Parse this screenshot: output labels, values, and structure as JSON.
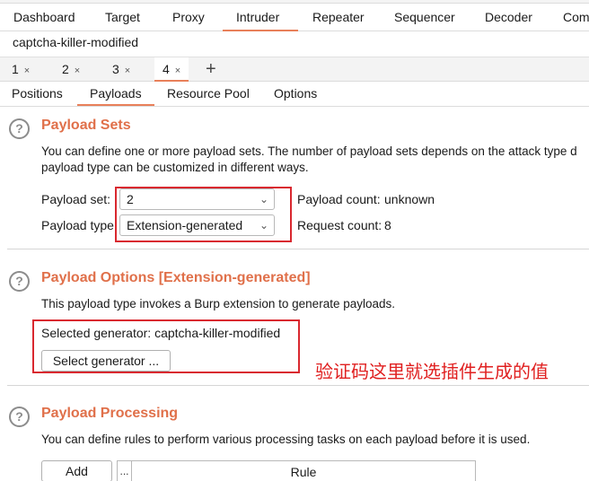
{
  "main_tabs": [
    "Dashboard",
    "Target",
    "Proxy",
    "Intruder",
    "Repeater",
    "Sequencer",
    "Decoder",
    "Com"
  ],
  "project_title": "captcha-killer-modified",
  "attack_tabs": [
    "1",
    "2",
    "3",
    "4"
  ],
  "attack_tab_close": "×",
  "add_tab": "+",
  "sub_tabs": [
    "Positions",
    "Payloads",
    "Resource Pool",
    "Options"
  ],
  "help_glyph": "?",
  "payload_sets": {
    "title": "Payload Sets",
    "desc_line1": "You can define one or more payload sets. The number of payload sets depends on the attack type d",
    "desc_line2": "payload type can be customized in different ways.",
    "set_label": "Payload set:",
    "set_value": "2",
    "type_label": "Payload type:",
    "type_value": "Extension-generated",
    "count_label": "Payload count:",
    "count_value": "unknown",
    "request_label": "Request count:",
    "request_value": "8"
  },
  "payload_options": {
    "title": "Payload Options [Extension-generated]",
    "desc": "This payload type invokes a Burp extension to generate payloads.",
    "selected_label": "Selected generator:",
    "selected_value": "captcha-killer-modified",
    "select_button": "Select generator ..."
  },
  "annotation": "验证码这里就选插件生成的值",
  "payload_processing": {
    "title": "Payload Processing",
    "desc": "You can define rules to perform various processing tasks on each payload before it is used.",
    "add_button": "Add",
    "table_dots": "...",
    "rule_header": "Rule"
  },
  "colors": {
    "accent": "#e0704a",
    "annotation_red": "#d9282f",
    "tab_underline": "#e8805a"
  },
  "icons": {
    "dropdown": "chevron-down-icon",
    "help": "help-circle-icon",
    "close": "close-icon",
    "add": "plus-icon"
  }
}
